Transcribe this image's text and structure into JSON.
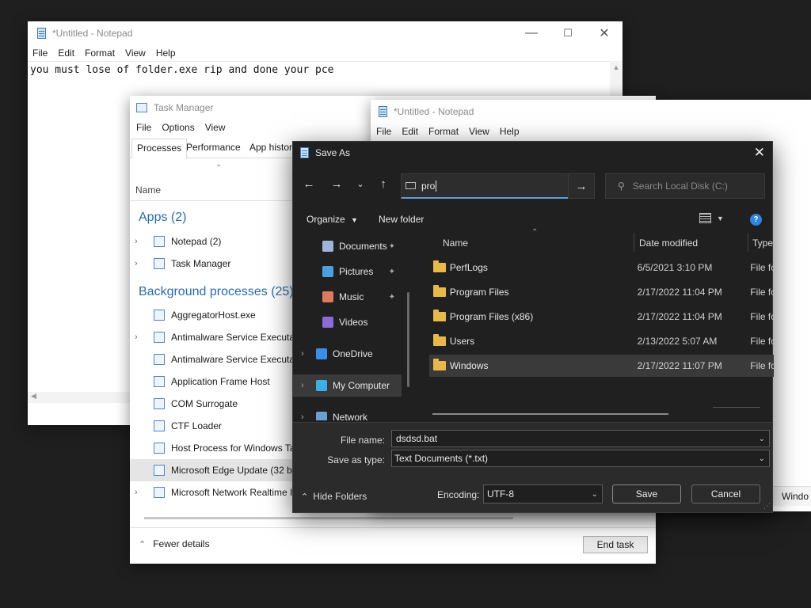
{
  "notepad1": {
    "title": "*Untitled - Notepad",
    "menu": [
      "File",
      "Edit",
      "Format",
      "View",
      "Help"
    ],
    "content": "you must lose of folder.exe rip and done your pce"
  },
  "taskmanager": {
    "title": "Task Manager",
    "menu": [
      "File",
      "Options",
      "View"
    ],
    "tabs": [
      "Processes",
      "Performance",
      "App histor"
    ],
    "column_name": "Name",
    "apps_header": "Apps (2)",
    "apps": [
      {
        "label": "Notepad (2)",
        "expandable": true
      },
      {
        "label": "Task Manager",
        "expandable": true
      }
    ],
    "bg_header": "Background processes (25)",
    "bg": [
      {
        "label": "AggregatorHost.exe",
        "expandable": false
      },
      {
        "label": "Antimalware Service Executal",
        "expandable": true
      },
      {
        "label": "Antimalware Service Executal",
        "expandable": false
      },
      {
        "label": "Application Frame Host",
        "expandable": false
      },
      {
        "label": "COM Surrogate",
        "expandable": false
      },
      {
        "label": "CTF Loader",
        "expandable": false
      },
      {
        "label": "Host Process for Windows Ta",
        "expandable": false
      },
      {
        "label": "Microsoft Edge Update (32 bi",
        "expandable": false
      },
      {
        "label": "Microsoft Network Realtime I",
        "expandable": true
      }
    ],
    "fewer_details": "Fewer details",
    "end_task": "End task"
  },
  "notepad2": {
    "title": "*Untitled - Notepad",
    "menu": [
      "File",
      "Edit",
      "Format",
      "View",
      "Help"
    ],
    "status_fragment": "Windo"
  },
  "saveas": {
    "title": "Save As",
    "address_value": "pro",
    "search_placeholder": "Search Local Disk (C:)",
    "organize": "Organize",
    "new_folder": "New folder",
    "nav": [
      {
        "label": "Documents",
        "pinned": true,
        "color": "#9fb4d6"
      },
      {
        "label": "Pictures",
        "pinned": true,
        "color": "#4aa0e0"
      },
      {
        "label": "Music",
        "pinned": true,
        "color": "#e07a5f"
      },
      {
        "label": "Videos",
        "pinned": false,
        "color": "#8b6cd6"
      },
      {
        "label": "OneDrive",
        "pinned": false,
        "color": "#3a8ee6"
      },
      {
        "label": "My Computer",
        "pinned": false,
        "color": "#3ab0e6"
      },
      {
        "label": "Network",
        "pinned": false,
        "color": "#6aa0d0"
      }
    ],
    "columns": [
      "Name",
      "Date modified",
      "Type"
    ],
    "files": [
      {
        "name": "PerfLogs",
        "date": "6/5/2021 3:10 PM",
        "type": "File fo"
      },
      {
        "name": "Program Files",
        "date": "2/17/2022 11:04 PM",
        "type": "File fo"
      },
      {
        "name": "Program Files (x86)",
        "date": "2/17/2022 11:04 PM",
        "type": "File fo"
      },
      {
        "name": "Users",
        "date": "2/13/2022 5:07 AM",
        "type": "File fo"
      },
      {
        "name": "Windows",
        "date": "2/17/2022 11:07 PM",
        "type": "File fo"
      }
    ],
    "file_name_label": "File name:",
    "file_name_value": "dsdsd.bat",
    "save_type_label": "Save as type:",
    "save_type_value": "Text Documents (*.txt)",
    "hide_folders": "Hide Folders",
    "encoding_label": "Encoding:",
    "encoding_value": "UTF-8",
    "save": "Save",
    "cancel": "Cancel"
  },
  "colors": {
    "dialog_bg": "#202020",
    "accent_blue": "#2a6ab0",
    "folder": "#e8b94a"
  }
}
